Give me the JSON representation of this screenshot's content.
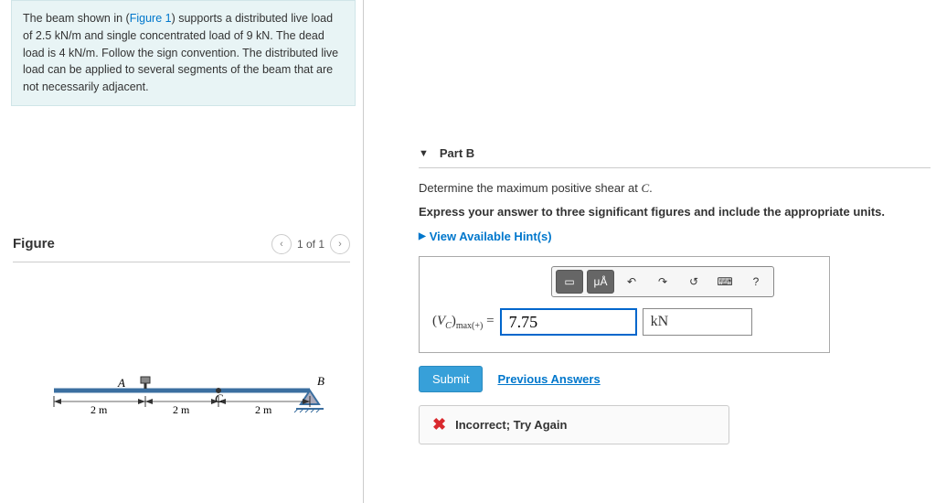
{
  "problem": {
    "text_prefix": "The beam shown in (",
    "figure_link": "Figure 1",
    "text_after_link": ") supports a distributed live load of 2.5 kN/m and single concentrated load of 9 kN. The dead load is 4 kN/m. Follow the sign convention. The distributed live load can be applied to several segments of the beam that are not necessarily adjacent."
  },
  "figure": {
    "title": "Figure",
    "counter": "1 of 1",
    "labels": {
      "A": "A",
      "B": "B",
      "C": "C",
      "dim": "2 m"
    }
  },
  "part": {
    "label": "Part B",
    "question_prefix": "Determine the maximum positive shear at ",
    "question_point": "C",
    "question_suffix": ".",
    "instruction": "Express your answer to three significant figures and include the appropriate units.",
    "hints_label": "View Available Hint(s)"
  },
  "toolbar_icons": {
    "template": "▭",
    "units": "μÅ",
    "undo": "↶",
    "redo": "↷",
    "reset": "↺",
    "keyboard": "⌨",
    "help": "?"
  },
  "answer": {
    "var_html": "(V_C)_max(+) =",
    "value": "7.75",
    "unit": "kN"
  },
  "buttons": {
    "submit": "Submit",
    "previous": "Previous Answers"
  },
  "feedback": {
    "text": "Incorrect; Try Again"
  }
}
